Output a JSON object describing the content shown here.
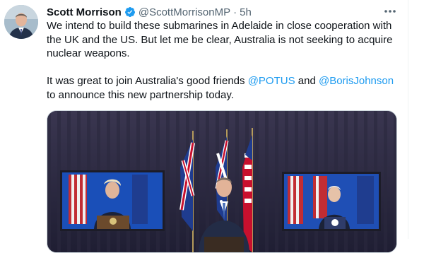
{
  "tweet": {
    "author_name": "Scott Morrison",
    "author_handle": "@ScottMorrisonMP",
    "separator": "·",
    "time": "5h",
    "paragraph1": "We intend to build these submarines in Adelaide in close cooperation with the UK and the US. But let me be clear, Australia is not seeking to acquire nuclear weapons.",
    "p2_before": "It was great to join Australia's good friends ",
    "p2_mention1": "@POTUS",
    "p2_and": " and ",
    "p2_mention2": "@BorisJohnson",
    "p2_after": " to announce this new partnership today."
  },
  "colors": {
    "accent": "#1d9bf0",
    "text": "#0f1419",
    "secondary": "#536471"
  },
  "icons": {
    "verified": "verified-badge-icon",
    "more": "more-options-icon"
  }
}
